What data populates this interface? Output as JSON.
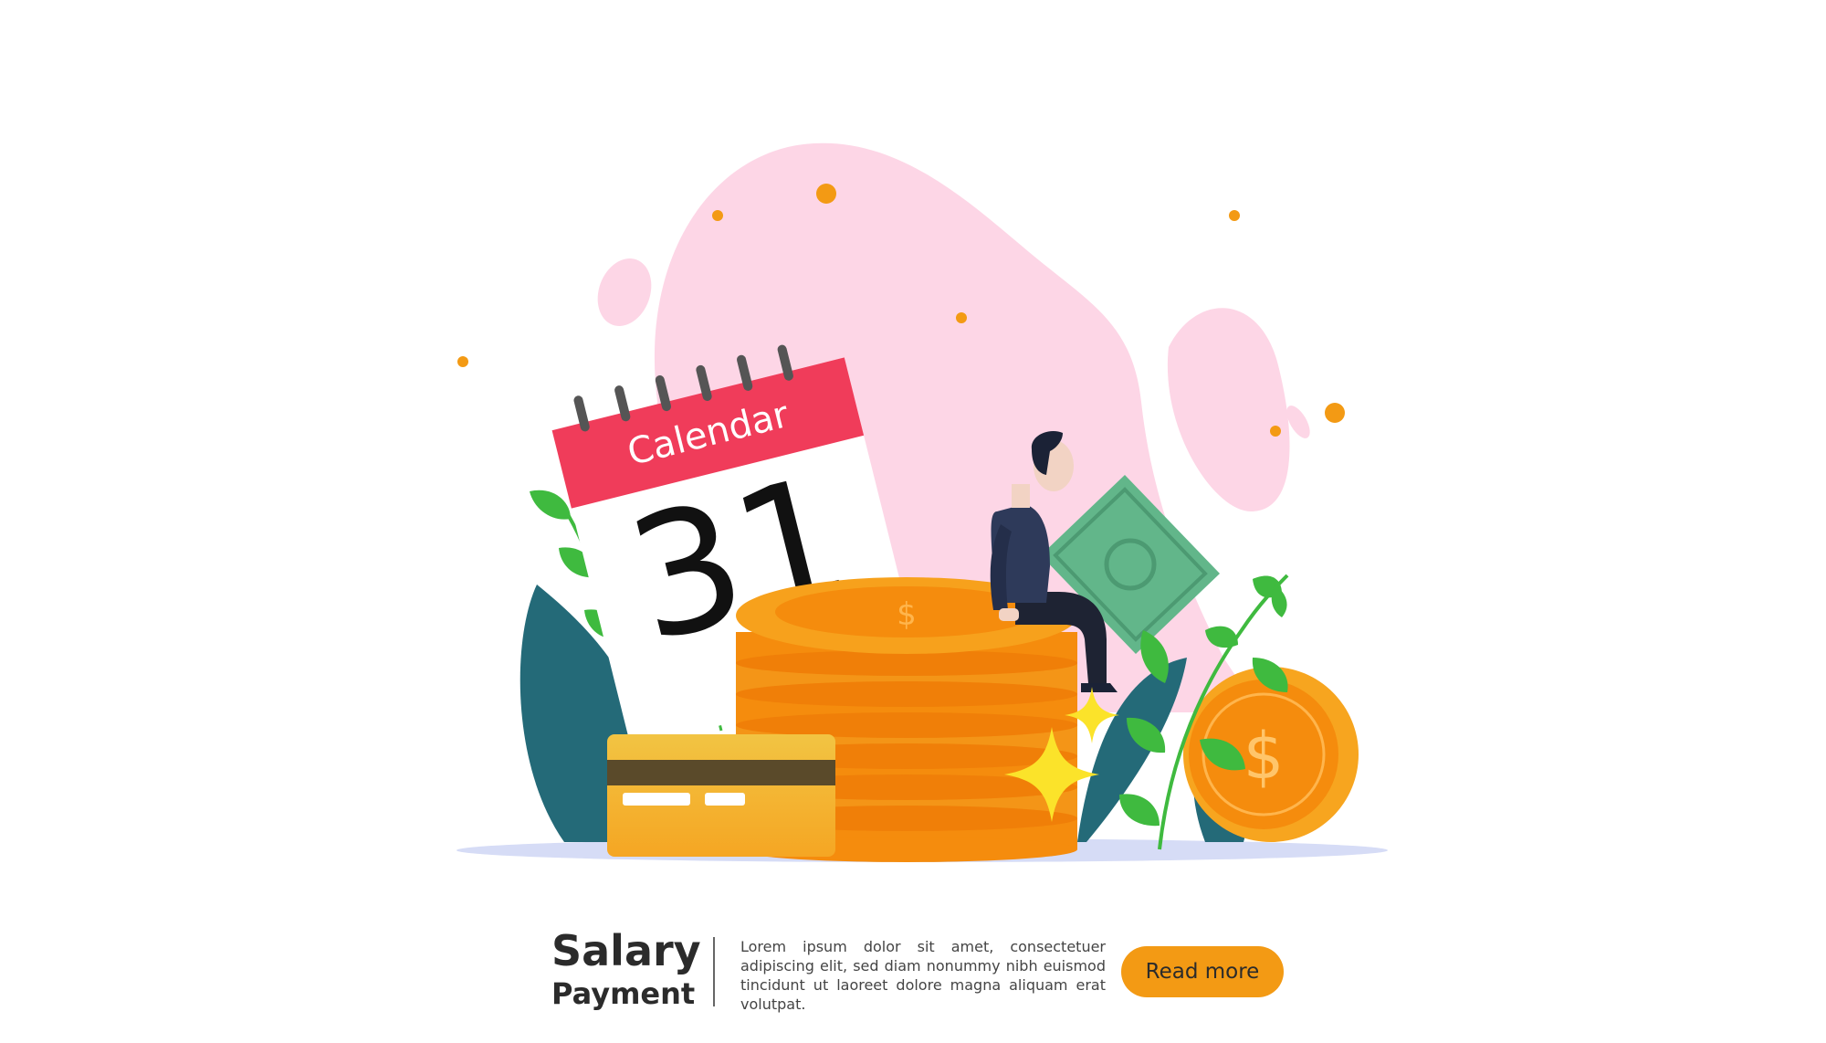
{
  "illustration": {
    "calendar": {
      "title": "Calendar",
      "day": "31"
    }
  },
  "footer": {
    "title_line1": "Salary",
    "title_line2": "Payment",
    "description": "Lorem ipsum dolor sit amet, consectetuer adipiscing elit, sed diam nonummy nibh euismod tincidunt ut laoreet dolore magna aliquam erat volutpat.",
    "button_label": "Read more"
  },
  "colors": {
    "accent_orange": "#f39a14",
    "coin_orange": "#f58c0d",
    "calendar_red": "#f03c5a",
    "blob_pink": "#fdd6e6",
    "leaf_teal": "#246a78",
    "leaf_green": "#3fba3f",
    "card_gold": "#f1b83c",
    "banknote_green": "#62b68a"
  }
}
